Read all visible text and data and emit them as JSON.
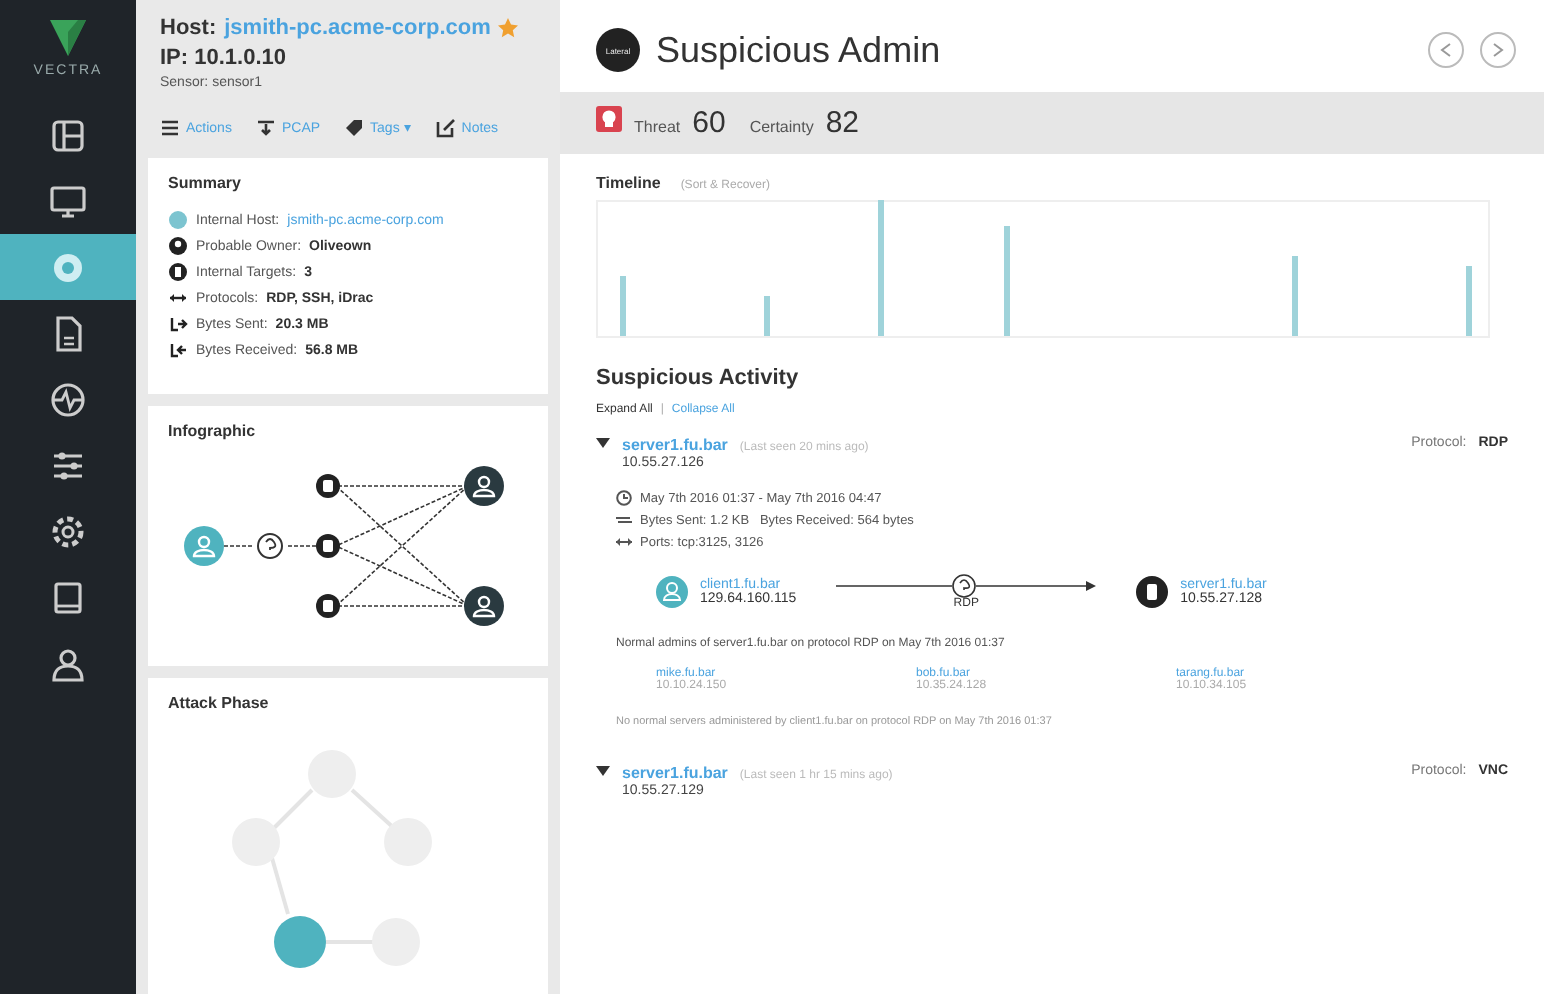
{
  "sidebar": {
    "logo": "VECTRA",
    "items": [
      {
        "kind": "grid",
        "selected": false
      },
      {
        "kind": "monitor",
        "selected": false
      },
      {
        "kind": "host",
        "selected": true
      },
      {
        "kind": "document",
        "selected": false
      },
      {
        "kind": "pulse",
        "selected": false
      },
      {
        "kind": "sliders",
        "selected": false
      },
      {
        "kind": "gear",
        "selected": false
      },
      {
        "kind": "book",
        "selected": false
      },
      {
        "kind": "person",
        "selected": false
      }
    ]
  },
  "host": {
    "label": "Host:",
    "name": "jsmith-pc.acme-corp.com",
    "starred": true,
    "ip": "IP: 10.1.0.10",
    "sensor": "Sensor: sensor1"
  },
  "toolbar": [
    {
      "kind": "list",
      "label": "Actions"
    },
    {
      "kind": "pcap",
      "label": "PCAP"
    },
    {
      "kind": "tag",
      "label": "Tags ▾"
    },
    {
      "kind": "note",
      "label": "Notes"
    }
  ],
  "summary": {
    "title": "Summary",
    "rows": [
      {
        "kind": "host",
        "label": "Internal Host:",
        "value": "jsmith-pc.acme-corp.com",
        "link": true
      },
      {
        "kind": "owner",
        "label": "Probable Owner:",
        "value": "Oliveown",
        "link": false
      },
      {
        "kind": "target",
        "label": "Internal Targets:",
        "value": "3",
        "link": false
      },
      {
        "kind": "protocol",
        "label": "Protocols:",
        "value": "RDP, SSH, iDrac",
        "link": false
      },
      {
        "kind": "sent",
        "label": "Bytes Sent:",
        "value": "20.3 MB",
        "link": false
      },
      {
        "kind": "received",
        "label": "Bytes Received:",
        "value": "56.8 MB",
        "link": false
      }
    ]
  },
  "infographic": {
    "title": "Infographic"
  },
  "attack_phase": {
    "title": "Attack Phase"
  },
  "detection": {
    "badge": "Lateral",
    "title": "Suspicious Admin"
  },
  "scores": {
    "threat_label": "Threat",
    "threat": "60",
    "certainty_label": "Certainty",
    "certainty": "82"
  },
  "timeline": {
    "title": "Timeline",
    "subtitle": "(Sort & Recover)"
  },
  "activity": {
    "title": "Suspicious Activity",
    "expand": "Expand All",
    "separator": "|",
    "collapse": "Collapse All"
  },
  "events": [
    {
      "expanded": true,
      "host": "server1.fu.bar",
      "seen": "(Last seen 20 mins ago)",
      "ip": "10.55.27.126",
      "protocol_label": "Protocol:",
      "protocol": "RDP",
      "details": {
        "time": "May 7th 2016 01:37 - May 7th 2016 04:47",
        "bytes": "Bytes Sent: 1.2 KB   Bytes Received: 564 bytes",
        "ports": "Ports: tcp:3125, 3126",
        "source": {
          "name": "client1.fu.bar",
          "ip": "129.64.160.115"
        },
        "link_label": "RDP",
        "target": {
          "name": "server1.fu.bar",
          "ip": "10.55.27.128"
        },
        "note": "Normal admins of server1.fu.bar on protocol RDP on May 7th 2016 01:37",
        "admins": [
          {
            "name": "mike.fu.bar",
            "ip": "10.10.24.150"
          },
          {
            "name": "bob.fu.bar",
            "ip": "10.35.24.128"
          },
          {
            "name": "tarang.fu.bar",
            "ip": "10.10.34.105"
          }
        ],
        "footnote": "No normal servers administered by client1.fu.bar on protocol RDP on May 7th 2016 01:37"
      }
    },
    {
      "expanded": true,
      "host": "server1.fu.bar",
      "seen": "(Last seen 1 hr 15 mins ago)",
      "ip": "10.55.27.129",
      "protocol_label": "Protocol:",
      "protocol": "VNC"
    }
  ]
}
